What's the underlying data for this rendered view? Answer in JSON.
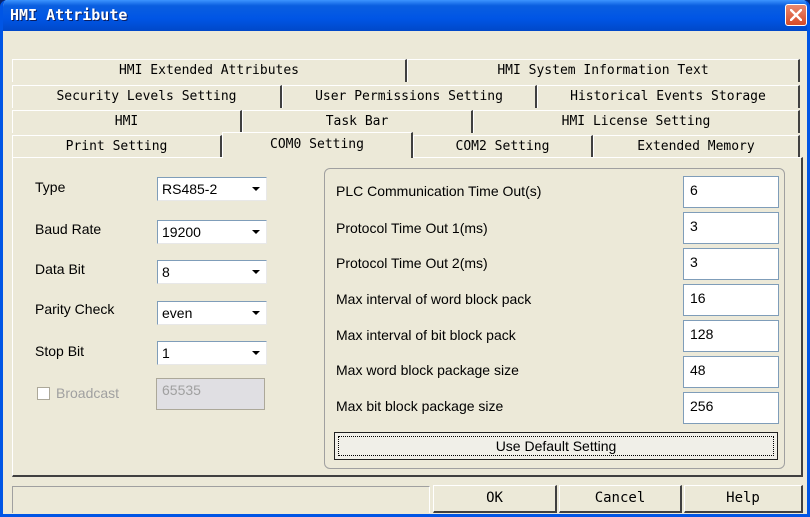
{
  "window": {
    "title": "HMI Attribute"
  },
  "tabs": {
    "row1": [
      "HMI Extended Attributes",
      "HMI System Information Text"
    ],
    "row2": [
      "Security Levels Setting",
      "User Permissions Setting",
      "Historical Events Storage"
    ],
    "row3": [
      "HMI",
      "Task Bar",
      "HMI License Setting"
    ],
    "row4": [
      "Print Setting",
      "COM0 Setting",
      "COM2 Setting",
      "Extended Memory"
    ],
    "active": "COM0 Setting"
  },
  "left": {
    "type_label": "Type",
    "type_value": "RS485-2",
    "baud_label": "Baud Rate",
    "baud_value": "19200",
    "databit_label": "Data Bit",
    "databit_value": "8",
    "parity_label": "Parity Check",
    "parity_value": "even",
    "stopbit_label": "Stop Bit",
    "stopbit_value": "1",
    "broadcast_label": "Broadcast",
    "broadcast_checked": false,
    "broadcast_value": "65535"
  },
  "right": {
    "fields": [
      {
        "label": "PLC Communication Time Out(s)",
        "value": "6"
      },
      {
        "label": "Protocol Time Out 1(ms)",
        "value": "3"
      },
      {
        "label": "Protocol Time Out 2(ms)",
        "value": "3"
      },
      {
        "label": "Max interval of word block pack",
        "value": "16"
      },
      {
        "label": "Max interval of bit block pack",
        "value": "128"
      },
      {
        "label": "Max word block package size",
        "value": "48"
      },
      {
        "label": "Max bit block package size",
        "value": "256"
      }
    ],
    "default_button": "Use Default Setting"
  },
  "footer": {
    "ok": "OK",
    "cancel": "Cancel",
    "help": "Help"
  },
  "colors": {
    "titlebar": "#0055e5",
    "face": "#ece9d8",
    "close": "#d64a28"
  }
}
